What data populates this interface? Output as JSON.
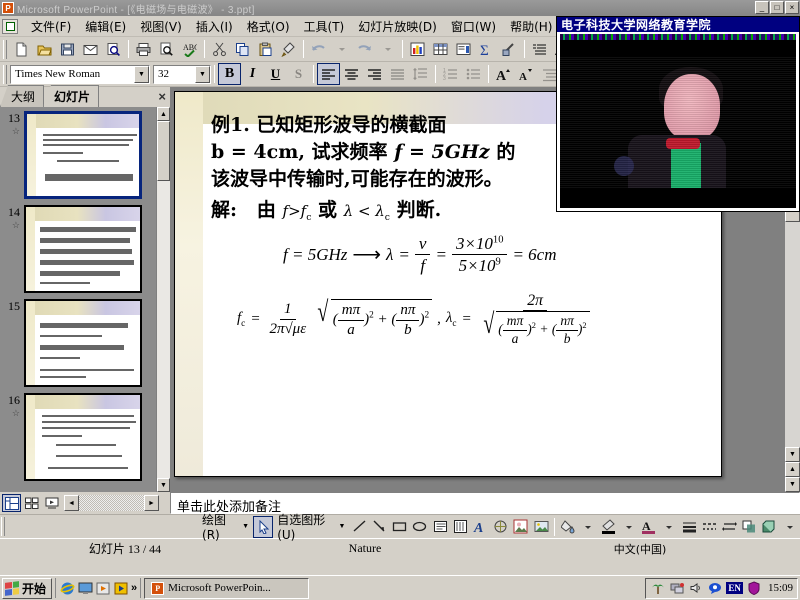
{
  "window": {
    "title": "Microsoft PowerPoint - [《电磁场与电磁波》 - 3.ppt]",
    "minimize_label": "_",
    "maximize_label": "□",
    "close_label": "×",
    "menu_close_label": "×"
  },
  "menu": {
    "items": [
      {
        "label": "文件(F)",
        "name": "menu-file"
      },
      {
        "label": "编辑(E)",
        "name": "menu-edit"
      },
      {
        "label": "视图(V)",
        "name": "menu-view"
      },
      {
        "label": "插入(I)",
        "name": "menu-insert"
      },
      {
        "label": "格式(O)",
        "name": "menu-format"
      },
      {
        "label": "工具(T)",
        "name": "menu-tools"
      },
      {
        "label": "幻灯片放映(D)",
        "name": "menu-slideshow"
      },
      {
        "label": "窗口(W)",
        "name": "menu-window"
      },
      {
        "label": "帮助(H)",
        "name": "menu-help"
      }
    ]
  },
  "standard_toolbar": {
    "icons": [
      "new-document-icon",
      "open-folder-icon",
      "save-disk-icon",
      "email-icon",
      "search-icon",
      "print-icon",
      "print-preview-icon",
      "spelling-check-icon",
      "cut-scissors-icon",
      "copy-icon",
      "paste-clipboard-icon",
      "format-painter-icon",
      "undo-icon",
      "redo-icon",
      "insert-chart-icon",
      "insert-table-icon",
      "insert-slide-icon",
      "sum-icon",
      "hyperlink-icon",
      "outline-list-icon",
      "expand-text-icon",
      "grid-icon"
    ]
  },
  "formatting_toolbar": {
    "font_name": "Times New Roman",
    "font_size": "32",
    "bold_label": "B",
    "italic_label": "I",
    "underline_label": "U",
    "shadow_label": "S",
    "dropdown_caret": "▼",
    "icons": [
      "align-left-icon",
      "align-center-icon",
      "align-right-icon",
      "justify-icon",
      "line-spacing-icon",
      "numbered-list-icon",
      "bulleted-list-icon",
      "increase-font-icon",
      "decrease-font-icon",
      "demote-icon"
    ]
  },
  "left_pane": {
    "tabs": [
      {
        "label": "大纲",
        "name": "tab-outline",
        "active": false
      },
      {
        "label": "幻灯片",
        "name": "tab-slides",
        "active": true
      }
    ],
    "close_label": "×",
    "slides": [
      {
        "number": "13",
        "marker": "☆",
        "selected": true
      },
      {
        "number": "14",
        "marker": "☆",
        "selected": false
      },
      {
        "number": "15",
        "marker": "",
        "selected": false
      },
      {
        "number": "16",
        "marker": "☆",
        "selected": false
      }
    ],
    "scroll_up": "▲",
    "scroll_down": "▼"
  },
  "slide": {
    "line1": "例1. 已知矩形波导的横截面",
    "line2_a": "b = 4cm,  试求频率",
    "line2_f": "f = 5GHz",
    "line2_b": "的",
    "line3": "该波导中传输时,可能存在的波形。",
    "solve_label": "解:",
    "solve_text_a": "由",
    "solve_f": "f>f",
    "solve_fc_sub": "c",
    "solve_text_b": "或",
    "solve_lambda": "λ < λ",
    "solve_lambda_sub": "c",
    "solve_text_c": "判断.",
    "eq1_lhs": "f = 5GHz",
    "eq1_arrow": "⟶",
    "eq1_lambda": "λ",
    "eq1_eq": "=",
    "eq1_num1": "v",
    "eq1_den1": "f",
    "eq1_num2": "3×10",
    "eq1_num2_sup": "10",
    "eq1_den2": "5×10",
    "eq1_den2_sup": "9",
    "eq1_result": "= 6cm",
    "eq2_fc": "f",
    "eq2_fc_sub": "c",
    "eq2_eq": "=",
    "eq2_num": "1",
    "eq2_den": "2π√με",
    "eq2_radicand_a": "mπ",
    "eq2_radicand_a_den": "a",
    "eq2_radicand_b": "nπ",
    "eq2_radicand_b_den": "b",
    "eq2_sup": "2",
    "eq2_plus": "+",
    "eq2_comma": ",",
    "eq3_lambda": "λ",
    "eq3_lambda_sub": "c",
    "eq3_eq": "=",
    "eq3_num": "2π"
  },
  "view_buttons": {
    "icons": [
      "normal-view-icon",
      "slide-sorter-view-icon",
      "slide-show-view-icon"
    ],
    "active_index": 0,
    "hscroll_left": "◄",
    "hscroll_right": "►"
  },
  "notes": {
    "placeholder": "单击此处添加备注"
  },
  "drawing_toolbar": {
    "draw_label": "绘图(R)",
    "autoshapes_label": "自选图形(U)",
    "caret": "▼",
    "icons": [
      "select-arrow-icon",
      "line-icon",
      "arrow-icon",
      "rectangle-icon",
      "oval-icon",
      "text-box-icon",
      "vertical-text-icon",
      "wordart-icon",
      "diagram-icon",
      "clip-art-icon",
      "insert-picture-icon",
      "fill-color-icon",
      "line-color-icon",
      "font-color-icon",
      "line-style-icon",
      "dash-style-icon",
      "arrow-style-icon",
      "shadow-style-icon",
      "3d-style-icon"
    ]
  },
  "status_bar": {
    "slide_counter": "幻灯片 13 / 44",
    "design_template": "Nature",
    "language": "中文(中国)"
  },
  "video_overlay": {
    "title": "电子科技大学网络教育学院"
  },
  "taskbar": {
    "start_label": "开始",
    "quick_launch": [
      "internet-explorer-icon",
      "show-desktop-icon",
      "media-player-icon",
      "play-icon"
    ],
    "more_label": "»",
    "task_button": "Microsoft PowerPoin...",
    "tray_icons": [
      "palm-tray-icon",
      "network-icon",
      "volume-icon",
      "messenger-icon",
      "shield-icon"
    ],
    "language_indicator": "EN",
    "clock": "15:09"
  },
  "colors": {
    "titlebar": "#8a8a8a",
    "chrome": "#d4d0c8",
    "selection": "#08246b",
    "video_title": "#000080"
  }
}
